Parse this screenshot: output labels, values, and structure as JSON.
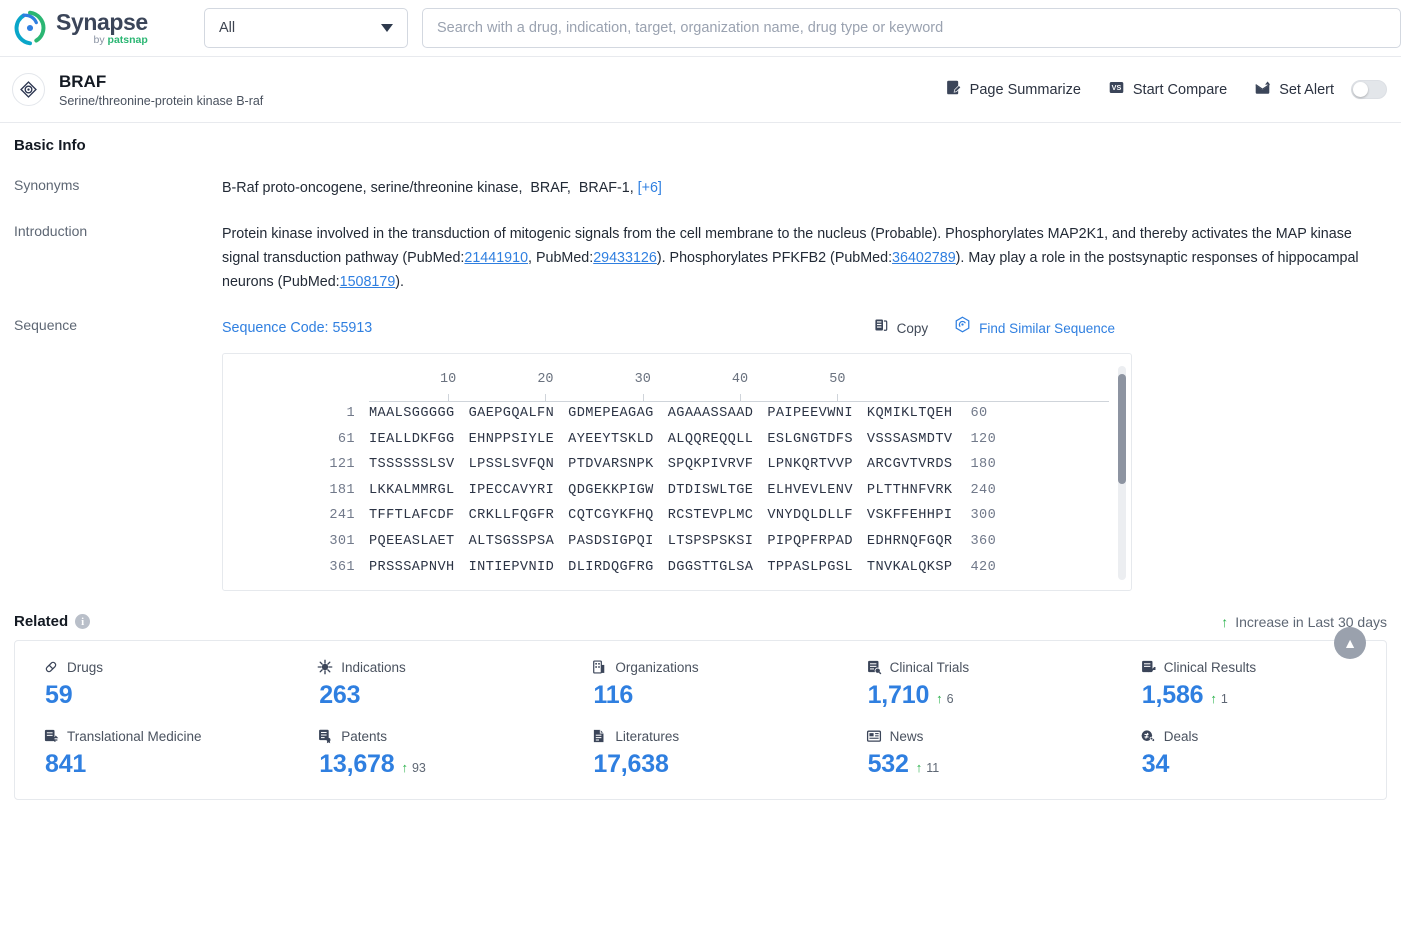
{
  "brand": {
    "name": "Synapse",
    "by": "by",
    "vendor": "patsnap",
    "logo_icon": "synapse-logo-icon"
  },
  "search": {
    "scope_value": "All",
    "scope_icon": "chevron-down-icon",
    "placeholder": "Search with a drug, indication, target, organization name, drug type or keyword",
    "value": ""
  },
  "entity": {
    "icon": "target-icon",
    "name": "BRAF",
    "description": "Serine/threonine-protein kinase B-raf",
    "actions": [
      {
        "label": "Page Summarize",
        "icon": "page-summarize-icon"
      },
      {
        "label": "Start Compare",
        "icon": "vs-compare-icon"
      },
      {
        "label": "Set Alert",
        "icon": "alert-mail-icon"
      }
    ],
    "alert_toggle_on": false
  },
  "basic_info": {
    "title": "Basic Info",
    "synonyms": {
      "label": "Synonyms",
      "items": [
        "B-Raf proto-oncogene, serine/threonine kinase",
        "BRAF",
        "BRAF-1"
      ],
      "more": "[+6]"
    },
    "introduction": {
      "label": "Introduction",
      "parts": [
        {
          "t": "text",
          "v": "Protein kinase involved in the transduction of mitogenic signals from the cell membrane to the nucleus (Probable). Phosphorylates MAP2K1, and thereby activates the MAP kinase signal transduction pathway (PubMed:"
        },
        {
          "t": "link",
          "v": "21441910"
        },
        {
          "t": "text",
          "v": ", PubMed:"
        },
        {
          "t": "link",
          "v": "29433126"
        },
        {
          "t": "text",
          "v": "). Phosphorylates PFKFB2 (PubMed:"
        },
        {
          "t": "link",
          "v": "36402789"
        },
        {
          "t": "text",
          "v": "). May play a role in the postsynaptic responses of hippocampal neurons (PubMed:"
        },
        {
          "t": "link",
          "v": "1508179"
        },
        {
          "t": "text",
          "v": ")."
        }
      ]
    },
    "sequence": {
      "label": "Sequence",
      "code_label": "Sequence Code: 55913",
      "copy_label": "Copy",
      "copy_icon": "copy-icon",
      "find_label": "Find Similar Sequence",
      "find_icon": "find-similar-icon",
      "ruler_ticks": [
        10,
        20,
        30,
        40,
        50
      ],
      "rows": [
        {
          "start": "1",
          "blocks": [
            "MAALSGGGGG",
            "GAEPGQALFN",
            "GDMEPEAGAG",
            "AGAAASSAAD",
            "PAIPEEVWNI",
            "KQMIKLTQEH"
          ],
          "end": "60"
        },
        {
          "start": "61",
          "blocks": [
            "IEALLDKFGG",
            "EHNPPSIYLE",
            "AYEEYTSKLD",
            "ALQQREQQLL",
            "ESLGNGTDFS",
            "VSSSASMDTV"
          ],
          "end": "120"
        },
        {
          "start": "121",
          "blocks": [
            "TSSSSSSLSV",
            "LPSSLSVFQN",
            "PTDVARSNPK",
            "SPQKPIVRVF",
            "LPNKQRTVVP",
            "ARCGVTVRDS"
          ],
          "end": "180"
        },
        {
          "start": "181",
          "blocks": [
            "LKKALMMRGL",
            "IPECCAVYRI",
            "QDGEKKPIGW",
            "DTDISWLTGE",
            "ELHVEVLENV",
            "PLTTHNFVRK"
          ],
          "end": "240"
        },
        {
          "start": "241",
          "blocks": [
            "TFFTLAFCDF",
            "CRKLLFQGFR",
            "CQTCGYKFHQ",
            "RCSTEVPLMC",
            "VNYDQLDLLF",
            "VSKFFEHHPI"
          ],
          "end": "300"
        },
        {
          "start": "301",
          "blocks": [
            "PQEEASLAET",
            "ALTSGSSPSA",
            "PASDSIGPQI",
            "LTSPSPSKSI",
            "PIPQPFRPAD",
            "EDHRNQFGQR"
          ],
          "end": "360"
        },
        {
          "start": "361",
          "blocks": [
            "PRSSSAPNVH",
            "INTIEPVNID",
            "DLIRDQGFRG",
            "DGGSTTGLSA",
            "TPPASLPGSL",
            "TNVKALQKSP"
          ],
          "end": "420"
        }
      ]
    }
  },
  "related": {
    "title": "Related",
    "info_icon": "info-icon",
    "legend": "Increase in Last 30 days",
    "legend_arrow": "up-arrow-icon",
    "scroll_top_icon": "scroll-to-top-icon",
    "metrics": [
      {
        "label": "Drugs",
        "icon": "drugs-icon",
        "value": "59",
        "delta": ""
      },
      {
        "label": "Indications",
        "icon": "indications-icon",
        "value": "263",
        "delta": ""
      },
      {
        "label": "Organizations",
        "icon": "organizations-icon",
        "value": "116",
        "delta": ""
      },
      {
        "label": "Clinical Trials",
        "icon": "clinical-trials-icon",
        "value": "1,710",
        "delta": "6"
      },
      {
        "label": "Clinical Results",
        "icon": "clinical-results-icon",
        "value": "1,586",
        "delta": "1"
      },
      {
        "label": "Translational Medicine",
        "icon": "translational-medicine-icon",
        "value": "841",
        "delta": ""
      },
      {
        "label": "Patents",
        "icon": "patents-icon",
        "value": "13,678",
        "delta": "93"
      },
      {
        "label": "Literatures",
        "icon": "literatures-icon",
        "value": "17,638",
        "delta": ""
      },
      {
        "label": "News",
        "icon": "news-icon",
        "value": "532",
        "delta": "11"
      },
      {
        "label": "Deals",
        "icon": "deals-icon",
        "value": "34",
        "delta": ""
      }
    ]
  },
  "colors": {
    "accent_blue": "#2f7fe0",
    "increase_green": "#2bb24c",
    "text_dark": "#141a23",
    "text_muted": "#5e6774"
  }
}
